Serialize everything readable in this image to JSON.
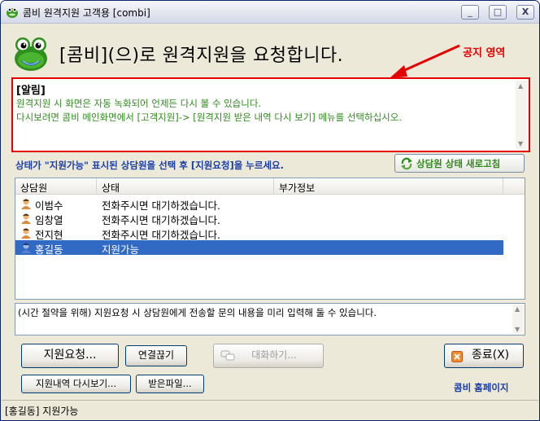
{
  "window": {
    "title": "콤비 원격지원 고객용 [combi]",
    "controls": {
      "minimize": "_",
      "maximize": "□",
      "close": "X"
    }
  },
  "header": {
    "title": "[콤비](으)로 원격지원을 요청합니다.",
    "notice_annotation": "공지 영역"
  },
  "notice": {
    "title": "[알림]",
    "lines": [
      "원격지원 시 화면은 자동 녹화되어 언제든 다시 볼 수 있습니다.",
      "다시보려면 콤비 메인화면에서 [고객지원]-> [원격지원 받은 내역 다시 보기] 메뉴를 선택하십시오."
    ]
  },
  "instruction": "상태가 \"지원가능\" 표시된 상담원을 선택 후 [지원요청]을 누르세요.",
  "refresh_button": "상담원 상태 새로고침",
  "agents": {
    "columns": [
      "상담원",
      "상태",
      "부가정보"
    ],
    "rows": [
      {
        "name": "이범수",
        "status": "전화주시면 대기하겠습니다.",
        "info": ""
      },
      {
        "name": "임창열",
        "status": "전화주시면 대기하겠습니다.",
        "info": ""
      },
      {
        "name": "전지현",
        "status": "전화주시면 대기하겠습니다.",
        "info": ""
      },
      {
        "name": "홍길동",
        "status": "지원가능",
        "info": "",
        "selected": true
      }
    ]
  },
  "memo": {
    "placeholder": "(시간 절약을 위해) 지원요청 시 상담원에게 전송할 문의 내용을 미리 입력해 둘 수 있습니다."
  },
  "buttons": {
    "request_support": "지원요청...",
    "disconnect": "연결끊기",
    "chat": "대화하기...",
    "exit": "종료(X)",
    "history": "지원내역 다시보기...",
    "received_files": "받은파일..."
  },
  "homepage_link": "콤비 홈페이지",
  "status_bar": "[홍길동] 지원가능",
  "colors": {
    "accent_red": "#e60000",
    "green_text": "#2f8a1c",
    "blue_text": "#1a3ea8",
    "selection": "#316ac5"
  }
}
